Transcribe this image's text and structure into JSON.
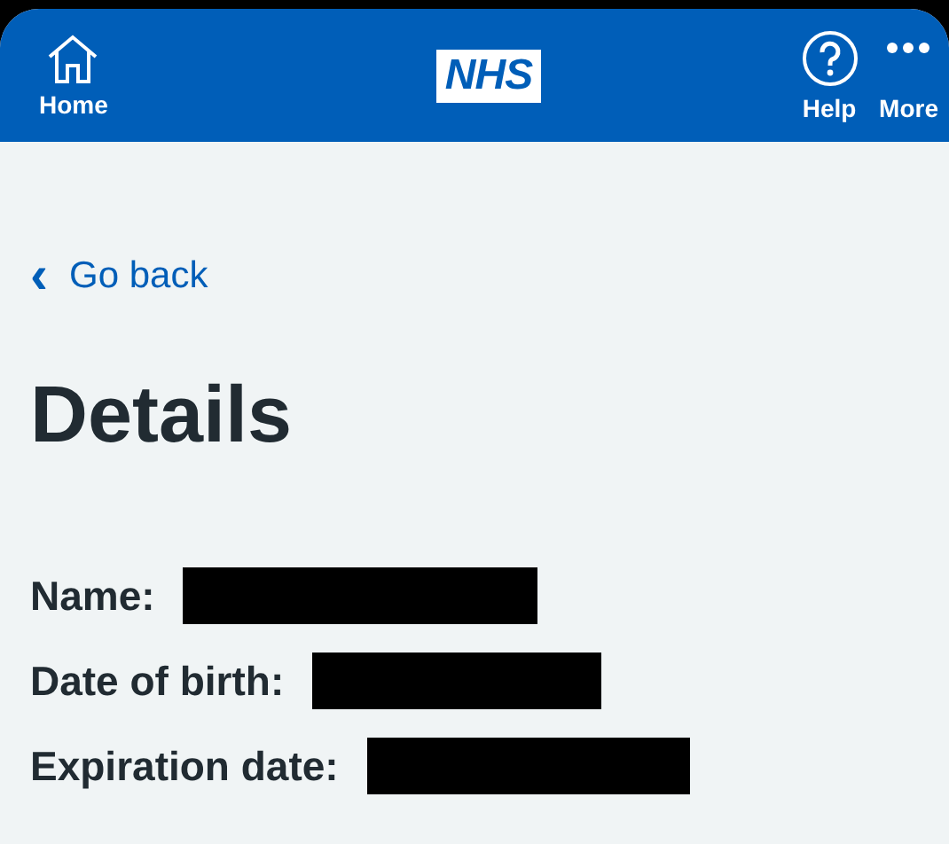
{
  "header": {
    "left": [
      {
        "kind": "home",
        "label": "Home"
      }
    ],
    "logo": "NHS",
    "right": [
      {
        "kind": "help",
        "label": "Help"
      },
      {
        "kind": "more",
        "label": "More"
      }
    ]
  },
  "back_link": {
    "icon": "‹",
    "label": "Go back"
  },
  "title": "Details",
  "details": [
    {
      "label": "Name:",
      "redacted": true
    },
    {
      "label": "Date of birth:",
      "redacted": true
    },
    {
      "label": "Expiration date:",
      "redacted": true
    }
  ]
}
